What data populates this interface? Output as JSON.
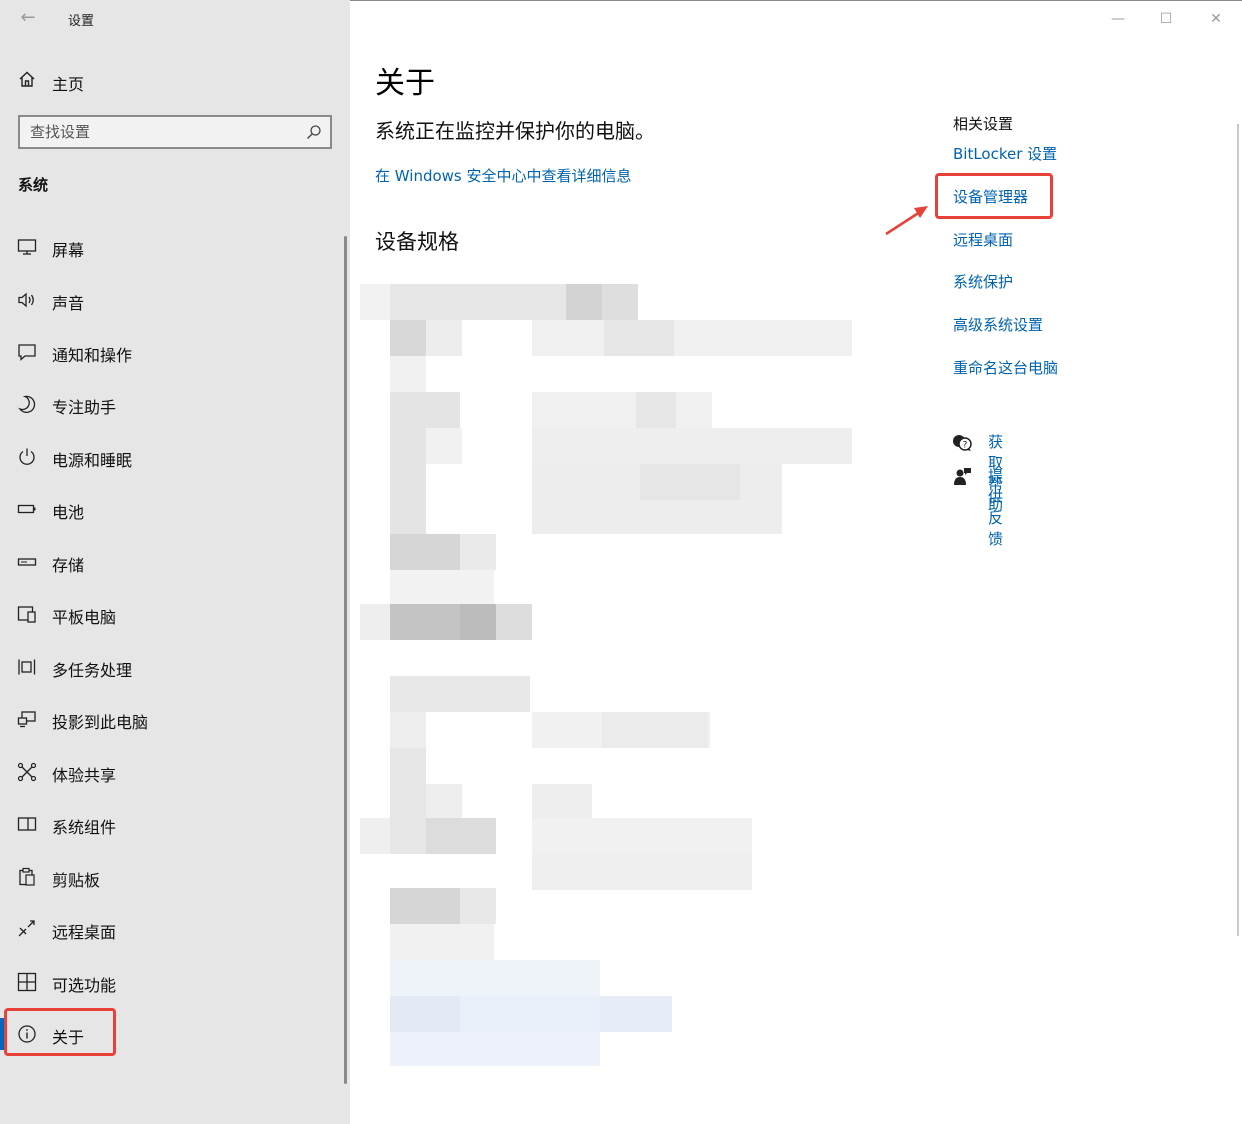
{
  "window": {
    "title": "设置",
    "back_icon": "back-arrow-icon",
    "minimize_glyph": "—",
    "maximize_glyph": "☐",
    "close_glyph": "✕"
  },
  "sidebar": {
    "home_label": "主页",
    "search_placeholder": "查找设置",
    "section_label": "系统",
    "items": [
      {
        "label": "屏幕",
        "icon": "monitor-icon"
      },
      {
        "label": "声音",
        "icon": "speaker-icon"
      },
      {
        "label": "通知和操作",
        "icon": "notification-icon"
      },
      {
        "label": "专注助手",
        "icon": "moon-icon"
      },
      {
        "label": "电源和睡眠",
        "icon": "power-icon"
      },
      {
        "label": "电池",
        "icon": "battery-icon"
      },
      {
        "label": "存储",
        "icon": "storage-icon"
      },
      {
        "label": "平板电脑",
        "icon": "tablet-icon"
      },
      {
        "label": "多任务处理",
        "icon": "multitask-icon"
      },
      {
        "label": "投影到此电脑",
        "icon": "project-icon"
      },
      {
        "label": "体验共享",
        "icon": "share-icon"
      },
      {
        "label": "系统组件",
        "icon": "components-icon"
      },
      {
        "label": "剪贴板",
        "icon": "clipboard-icon"
      },
      {
        "label": "远程桌面",
        "icon": "remote-desktop-icon"
      },
      {
        "label": "可选功能",
        "icon": "optional-features-icon"
      },
      {
        "label": "关于",
        "icon": "info-icon",
        "active": true
      }
    ]
  },
  "main": {
    "title": "关于",
    "status": "系统正在监控并保护你的电脑。",
    "security_link": "在 Windows 安全中心中查看详细信息",
    "spec_heading": "设备规格"
  },
  "related": {
    "title": "相关设置",
    "links": [
      "BitLocker 设置",
      "设备管理器",
      "远程桌面",
      "系统保护",
      "高级系统设置",
      "重命名这台电脑"
    ],
    "help": [
      {
        "label": "获取帮助",
        "icon": "help-chat-icon"
      },
      {
        "label": "提供反馈",
        "icon": "feedback-icon"
      }
    ]
  },
  "colors": {
    "sidebar_bg": "#e6e6e6",
    "link": "#0063b1",
    "accent": "#0067c0",
    "annotation": "#e8413a"
  }
}
